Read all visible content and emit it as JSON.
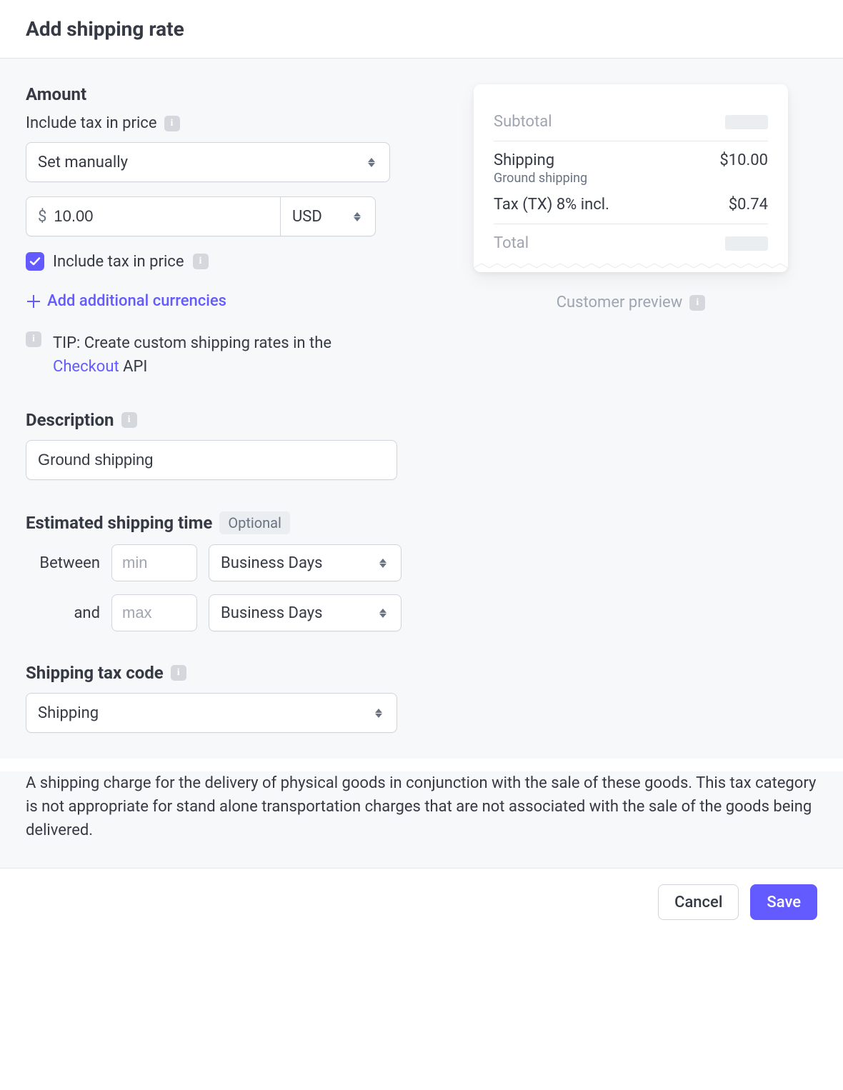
{
  "header": {
    "title": "Add shipping rate"
  },
  "amount": {
    "section_title": "Amount",
    "tax_label": "Include tax in price",
    "mode_select": "Set manually",
    "currency_prefix": "$",
    "value": "10.00",
    "currency": "USD",
    "include_tax_checkbox_label": "Include tax in price",
    "add_currencies_link": "Add additional currencies",
    "tip_prefix": "TIP: Create custom shipping rates in the ",
    "tip_link": "Checkout",
    "tip_suffix": " API"
  },
  "description": {
    "section_title": "Description",
    "value": "Ground shipping"
  },
  "shipping_time": {
    "section_title": "Estimated shipping time",
    "optional_badge": "Optional",
    "between_label": "Between",
    "and_label": "and",
    "min_placeholder": "min",
    "max_placeholder": "max",
    "min_value": "",
    "max_value": "",
    "unit_select": "Business Days"
  },
  "tax_code": {
    "section_title": "Shipping tax code",
    "value": "Shipping",
    "description": "A shipping charge for the delivery of physical goods in conjunction with the sale of these goods. This tax category is not appropriate for stand alone transportation charges that are not associated with the sale of the goods being delivered."
  },
  "preview": {
    "subtotal_label": "Subtotal",
    "shipping_label": "Shipping",
    "shipping_sub": "Ground shipping",
    "shipping_value": "$10.00",
    "tax_label": "Tax (TX) 8% incl.",
    "tax_value": "$0.74",
    "total_label": "Total",
    "caption": "Customer preview"
  },
  "footer": {
    "cancel": "Cancel",
    "save": "Save"
  }
}
